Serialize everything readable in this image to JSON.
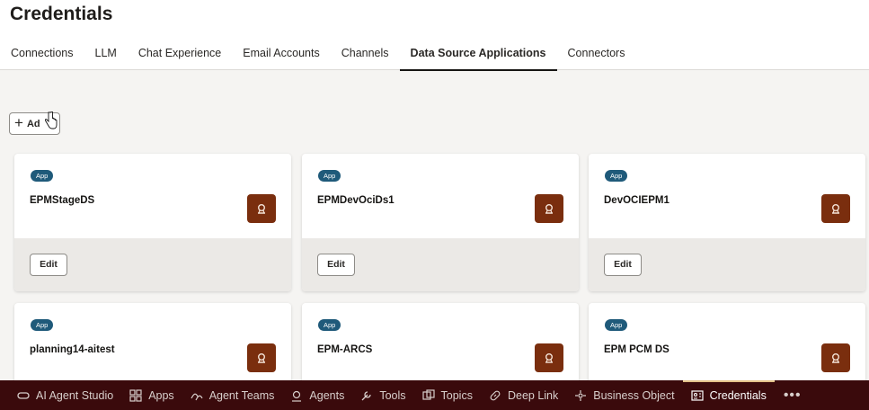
{
  "page": {
    "title": "Credentials"
  },
  "tabs": [
    {
      "label": "Connections"
    },
    {
      "label": "LLM"
    },
    {
      "label": "Chat Experience"
    },
    {
      "label": "Email Accounts"
    },
    {
      "label": "Channels"
    },
    {
      "label": "Data Source Applications",
      "active": true
    },
    {
      "label": "Connectors"
    }
  ],
  "toolbar": {
    "add_label": "Add",
    "add_label_visible": "Ad"
  },
  "cards": [
    {
      "badge": "App",
      "title": "EPMStageDS",
      "edit_label": "Edit"
    },
    {
      "badge": "App",
      "title": "EPMDevOciDs1",
      "edit_label": "Edit"
    },
    {
      "badge": "App",
      "title": "DevOCIEPM1",
      "edit_label": "Edit"
    },
    {
      "badge": "App",
      "title": "planning14-aitest",
      "edit_label": "Edit"
    },
    {
      "badge": "App",
      "title": "EPM-ARCS",
      "edit_label": "Edit"
    },
    {
      "badge": "App",
      "title": "EPM PCM DS",
      "edit_label": "Edit"
    }
  ],
  "bottom_nav": [
    {
      "label": "AI Agent Studio",
      "icon": "studio-icon"
    },
    {
      "label": "Apps",
      "icon": "apps-grid-icon"
    },
    {
      "label": "Agent Teams",
      "icon": "agent-teams-icon"
    },
    {
      "label": "Agents",
      "icon": "agents-icon"
    },
    {
      "label": "Tools",
      "icon": "tools-icon"
    },
    {
      "label": "Topics",
      "icon": "topics-icon"
    },
    {
      "label": "Deep Link",
      "icon": "link-icon"
    },
    {
      "label": "Business Object",
      "icon": "business-object-icon"
    },
    {
      "label": "Credentials",
      "icon": "credentials-icon",
      "active": true
    }
  ],
  "bottom_more": "•••",
  "colors": {
    "accent_bar": "#3a0a0c",
    "badge": "#1f5a7a",
    "app_icon": "#7a2e0e",
    "active_indicator": "#e4c28a"
  }
}
